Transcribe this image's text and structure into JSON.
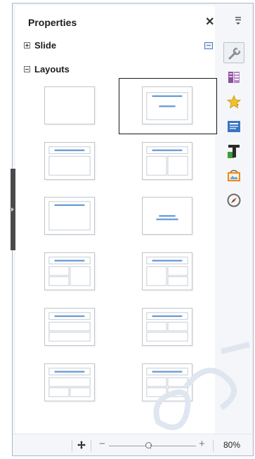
{
  "panel": {
    "title": "Properties",
    "close_glyph": "✕",
    "menu_icon": "panel-menu-icon"
  },
  "sections": {
    "slide": {
      "label": "Slide",
      "expanded": false
    },
    "layouts": {
      "label": "Layouts",
      "expanded": true
    }
  },
  "layouts": [
    {
      "name": "layout-blank",
      "selected": false
    },
    {
      "name": "layout-title-only",
      "selected": true
    },
    {
      "name": "layout-title-content",
      "selected": false
    },
    {
      "name": "layout-title-two-content",
      "selected": false
    },
    {
      "name": "layout-title-only-top",
      "selected": false
    },
    {
      "name": "layout-centered-text",
      "selected": false
    },
    {
      "name": "layout-title-content-two-content",
      "selected": false
    },
    {
      "name": "layout-title-two-content-content",
      "selected": false
    },
    {
      "name": "layout-title-content-over-content",
      "selected": false
    },
    {
      "name": "layout-title-two-content-over-content",
      "selected": false
    },
    {
      "name": "layout-title-two-content-over-two",
      "selected": false
    },
    {
      "name": "layout-title-four-content",
      "selected": false
    }
  ],
  "sidebar_icons": [
    "properties-wrench-icon",
    "slide-transition-icon",
    "animation-star-icon",
    "master-slides-icon",
    "styles-formatting-icon",
    "gallery-icon",
    "navigator-icon"
  ],
  "statusbar": {
    "fit_icon": "fit-slide-icon",
    "zoom_out": "−",
    "zoom_in": "+",
    "zoom_level": "80%",
    "zoom_fraction": 0.45
  },
  "colors": {
    "accent": "#6e9fd6",
    "selection_border": "#1a1a1a"
  }
}
